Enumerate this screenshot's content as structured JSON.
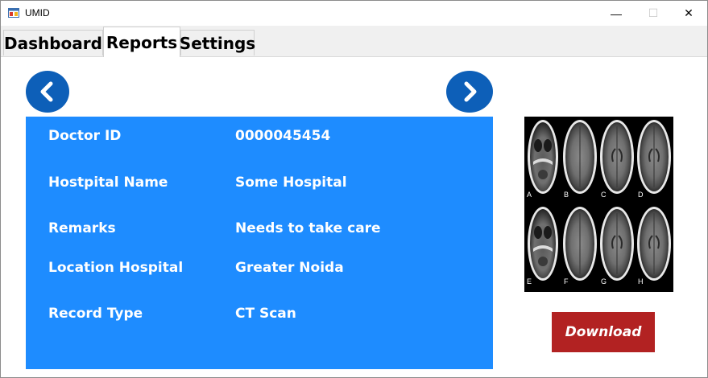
{
  "window": {
    "title": "UMID",
    "minimize_glyph": "—",
    "maximize_glyph": "☐",
    "close_glyph": "✕"
  },
  "tabs": [
    {
      "label": "Dashboard",
      "selected": false
    },
    {
      "label": "Reports",
      "selected": true
    },
    {
      "label": "Settings",
      "selected": false
    }
  ],
  "record": {
    "rows": [
      {
        "label": "Doctor ID",
        "value": "0000045454"
      },
      {
        "label": "Hostpital Name",
        "value": "Some Hospital"
      },
      {
        "label": "Remarks",
        "value": "Needs to take care"
      },
      {
        "label": "Location Hospital",
        "value": "Greater Noida"
      },
      {
        "label": "Record Type",
        "value": "CT Scan"
      }
    ]
  },
  "scan_image": {
    "panel_letters": [
      "A",
      "B",
      "C",
      "D",
      "E",
      "F",
      "G",
      "H"
    ]
  },
  "actions": {
    "download_label": "Download"
  },
  "icons": {
    "prev": "chevron-left-icon",
    "next": "chevron-right-icon",
    "app": "app-window-icon"
  },
  "colors": {
    "panel": "#1e8cff",
    "nav_button": "#0d5fb8",
    "download_button": "#b22222"
  }
}
